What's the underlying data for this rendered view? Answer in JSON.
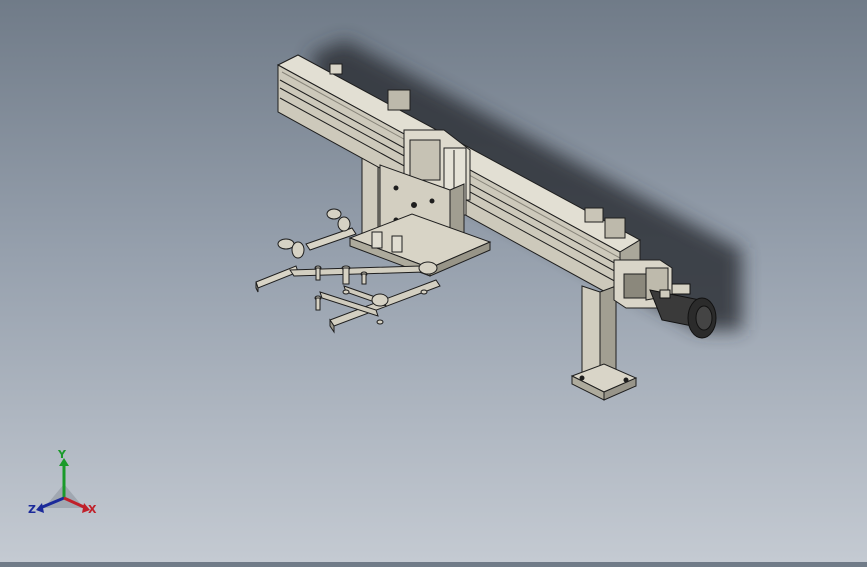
{
  "viewport": {
    "background_top": "#707b88",
    "background_bottom": "#c4cad2",
    "model_colors": {
      "body": "#d6d2c4",
      "shade": "#a8a598",
      "edge": "#1e1e1e",
      "motor": "#2a2a2a",
      "shadow": "#3b3f46"
    }
  },
  "triad": {
    "y_label": "Y",
    "z_label": "Z",
    "x_label": "X",
    "colors": {
      "y": "#1a9a2a",
      "z": "#1b2a9a",
      "x": "#c0202a"
    }
  }
}
